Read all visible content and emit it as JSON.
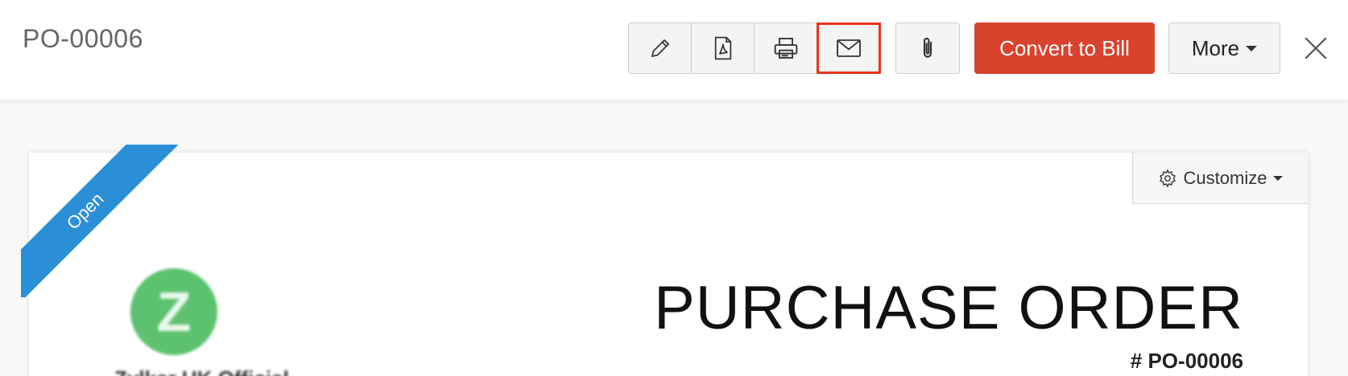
{
  "header": {
    "title": "PO-00006",
    "actions": {
      "edit_icon": "pencil-icon",
      "pdf_icon": "pdf-icon",
      "print_icon": "printer-icon",
      "email_icon": "mail-icon",
      "attach_icon": "paperclip-icon",
      "convert_label": "Convert to Bill",
      "more_label": "More",
      "close_icon": "close-icon"
    },
    "colors": {
      "convert_bg": "#d9432e",
      "highlight": "#e8341c"
    }
  },
  "document": {
    "status_ribbon": "Open",
    "status_color": "#2b8fd8",
    "customize_label": "Customize",
    "logo_letter": "Z",
    "company_name": "Zylker UK Official",
    "heading": "PURCHASE ORDER",
    "number": "# PO-00006"
  }
}
